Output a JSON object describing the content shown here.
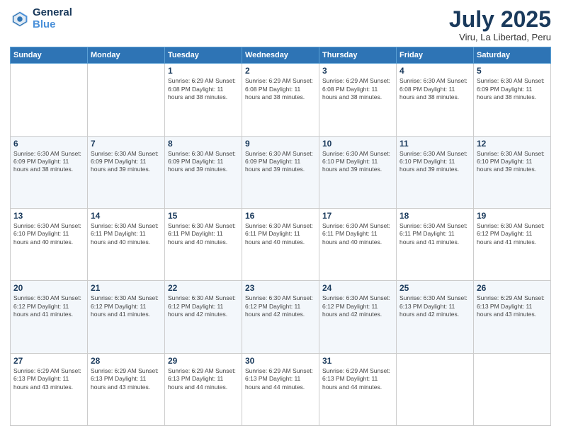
{
  "header": {
    "logo_line1": "General",
    "logo_line2": "Blue",
    "month_title": "July 2025",
    "location": "Viru, La Libertad, Peru"
  },
  "weekdays": [
    "Sunday",
    "Monday",
    "Tuesday",
    "Wednesday",
    "Thursday",
    "Friday",
    "Saturday"
  ],
  "weeks": [
    [
      {
        "day": "",
        "detail": ""
      },
      {
        "day": "",
        "detail": ""
      },
      {
        "day": "1",
        "detail": "Sunrise: 6:29 AM\nSunset: 6:08 PM\nDaylight: 11 hours and 38 minutes."
      },
      {
        "day": "2",
        "detail": "Sunrise: 6:29 AM\nSunset: 6:08 PM\nDaylight: 11 hours and 38 minutes."
      },
      {
        "day": "3",
        "detail": "Sunrise: 6:29 AM\nSunset: 6:08 PM\nDaylight: 11 hours and 38 minutes."
      },
      {
        "day": "4",
        "detail": "Sunrise: 6:30 AM\nSunset: 6:08 PM\nDaylight: 11 hours and 38 minutes."
      },
      {
        "day": "5",
        "detail": "Sunrise: 6:30 AM\nSunset: 6:09 PM\nDaylight: 11 hours and 38 minutes."
      }
    ],
    [
      {
        "day": "6",
        "detail": "Sunrise: 6:30 AM\nSunset: 6:09 PM\nDaylight: 11 hours and 38 minutes."
      },
      {
        "day": "7",
        "detail": "Sunrise: 6:30 AM\nSunset: 6:09 PM\nDaylight: 11 hours and 39 minutes."
      },
      {
        "day": "8",
        "detail": "Sunrise: 6:30 AM\nSunset: 6:09 PM\nDaylight: 11 hours and 39 minutes."
      },
      {
        "day": "9",
        "detail": "Sunrise: 6:30 AM\nSunset: 6:09 PM\nDaylight: 11 hours and 39 minutes."
      },
      {
        "day": "10",
        "detail": "Sunrise: 6:30 AM\nSunset: 6:10 PM\nDaylight: 11 hours and 39 minutes."
      },
      {
        "day": "11",
        "detail": "Sunrise: 6:30 AM\nSunset: 6:10 PM\nDaylight: 11 hours and 39 minutes."
      },
      {
        "day": "12",
        "detail": "Sunrise: 6:30 AM\nSunset: 6:10 PM\nDaylight: 11 hours and 39 minutes."
      }
    ],
    [
      {
        "day": "13",
        "detail": "Sunrise: 6:30 AM\nSunset: 6:10 PM\nDaylight: 11 hours and 40 minutes."
      },
      {
        "day": "14",
        "detail": "Sunrise: 6:30 AM\nSunset: 6:11 PM\nDaylight: 11 hours and 40 minutes."
      },
      {
        "day": "15",
        "detail": "Sunrise: 6:30 AM\nSunset: 6:11 PM\nDaylight: 11 hours and 40 minutes."
      },
      {
        "day": "16",
        "detail": "Sunrise: 6:30 AM\nSunset: 6:11 PM\nDaylight: 11 hours and 40 minutes."
      },
      {
        "day": "17",
        "detail": "Sunrise: 6:30 AM\nSunset: 6:11 PM\nDaylight: 11 hours and 40 minutes."
      },
      {
        "day": "18",
        "detail": "Sunrise: 6:30 AM\nSunset: 6:11 PM\nDaylight: 11 hours and 41 minutes."
      },
      {
        "day": "19",
        "detail": "Sunrise: 6:30 AM\nSunset: 6:12 PM\nDaylight: 11 hours and 41 minutes."
      }
    ],
    [
      {
        "day": "20",
        "detail": "Sunrise: 6:30 AM\nSunset: 6:12 PM\nDaylight: 11 hours and 41 minutes."
      },
      {
        "day": "21",
        "detail": "Sunrise: 6:30 AM\nSunset: 6:12 PM\nDaylight: 11 hours and 41 minutes."
      },
      {
        "day": "22",
        "detail": "Sunrise: 6:30 AM\nSunset: 6:12 PM\nDaylight: 11 hours and 42 minutes."
      },
      {
        "day": "23",
        "detail": "Sunrise: 6:30 AM\nSunset: 6:12 PM\nDaylight: 11 hours and 42 minutes."
      },
      {
        "day": "24",
        "detail": "Sunrise: 6:30 AM\nSunset: 6:12 PM\nDaylight: 11 hours and 42 minutes."
      },
      {
        "day": "25",
        "detail": "Sunrise: 6:30 AM\nSunset: 6:13 PM\nDaylight: 11 hours and 42 minutes."
      },
      {
        "day": "26",
        "detail": "Sunrise: 6:29 AM\nSunset: 6:13 PM\nDaylight: 11 hours and 43 minutes."
      }
    ],
    [
      {
        "day": "27",
        "detail": "Sunrise: 6:29 AM\nSunset: 6:13 PM\nDaylight: 11 hours and 43 minutes."
      },
      {
        "day": "28",
        "detail": "Sunrise: 6:29 AM\nSunset: 6:13 PM\nDaylight: 11 hours and 43 minutes."
      },
      {
        "day": "29",
        "detail": "Sunrise: 6:29 AM\nSunset: 6:13 PM\nDaylight: 11 hours and 44 minutes."
      },
      {
        "day": "30",
        "detail": "Sunrise: 6:29 AM\nSunset: 6:13 PM\nDaylight: 11 hours and 44 minutes."
      },
      {
        "day": "31",
        "detail": "Sunrise: 6:29 AM\nSunset: 6:13 PM\nDaylight: 11 hours and 44 minutes."
      },
      {
        "day": "",
        "detail": ""
      },
      {
        "day": "",
        "detail": ""
      }
    ]
  ]
}
